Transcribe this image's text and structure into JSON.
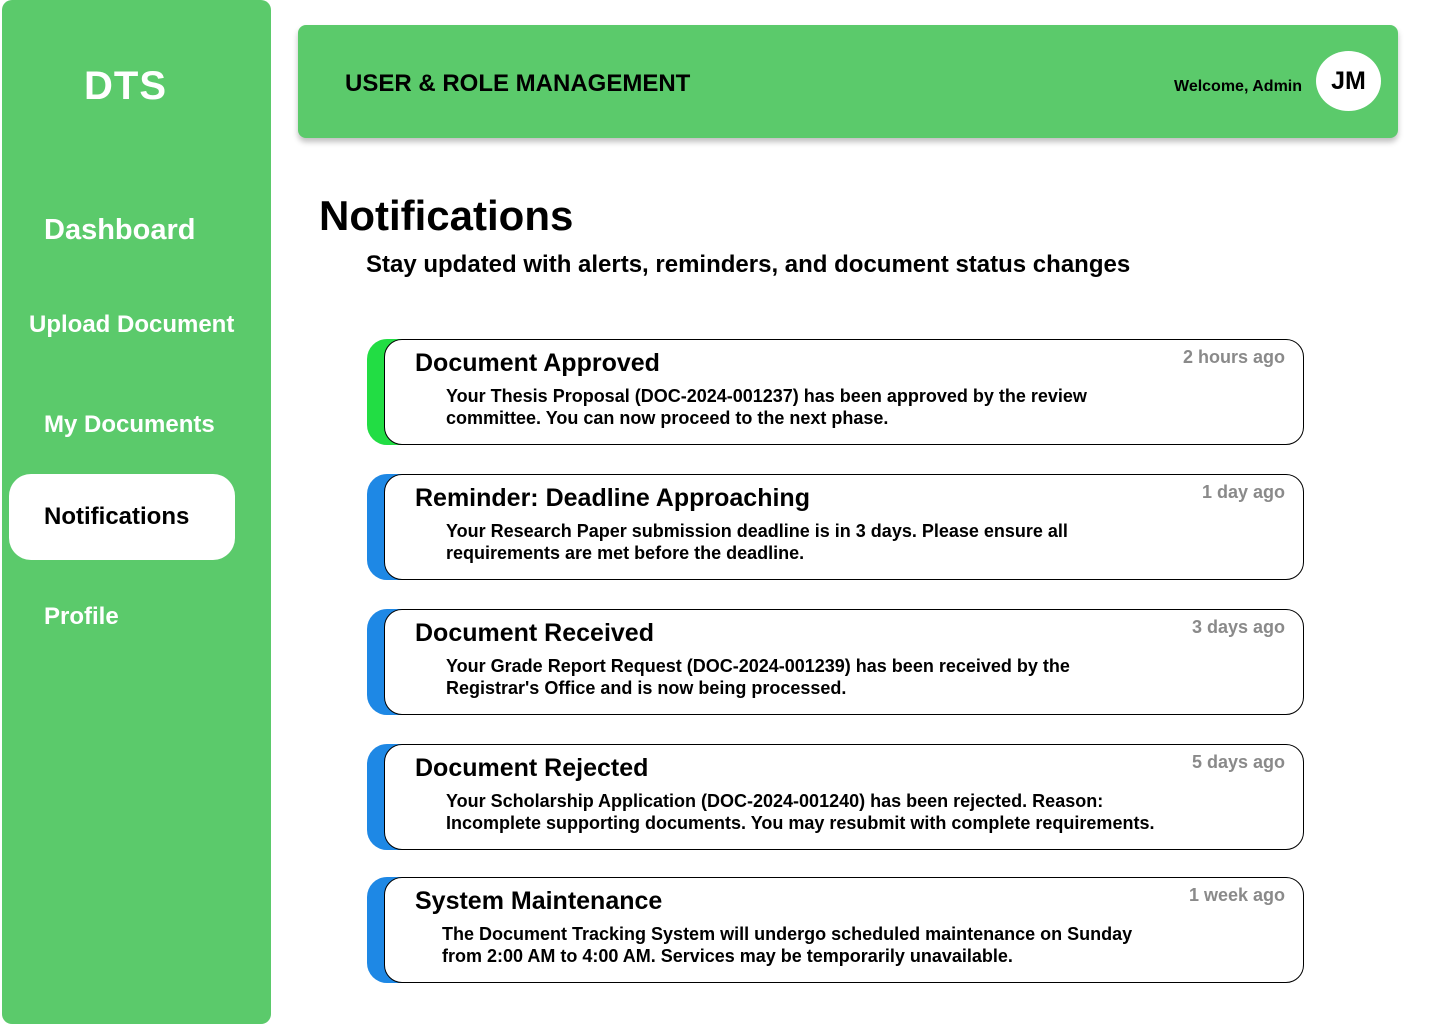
{
  "sidebar": {
    "brand": "DTS",
    "items": [
      {
        "label": "Dashboard"
      },
      {
        "label": "Upload Document"
      },
      {
        "label": "My Documents"
      },
      {
        "label": "Notifications",
        "active": true
      },
      {
        "label": "Profile"
      }
    ]
  },
  "header": {
    "title": "USER & ROLE MANAGEMENT",
    "welcome": "Welcome, Admin",
    "avatar_initials": "JM"
  },
  "page": {
    "title": "Notifications",
    "subtitle": "Stay updated with alerts, reminders, and document status changes"
  },
  "notifications": [
    {
      "title": "Document Approved",
      "time": "2 hours ago",
      "message": "Your Thesis Proposal (DOC-2024-001237) has been approved by the review committee. You can now proceed to the next phase.",
      "accent": "#22DD44"
    },
    {
      "title": "Reminder: Deadline Approaching",
      "time": "1 day ago",
      "message": "Your Research Paper submission deadline is in 3 days. Please ensure all requirements are met before the deadline.",
      "accent": "#1E88E5"
    },
    {
      "title": "Document Received",
      "time": "3 days ago",
      "message": "Your Grade Report Request (DOC-2024-001239) has been received by the Registrar's Office and is now being processed.",
      "accent": "#1E88E5"
    },
    {
      "title": "Document Rejected",
      "time": "5 days ago",
      "message": "Your Scholarship Application (DOC-2024-001240) has been rejected. Reason: Incomplete supporting documents. You may resubmit with complete requirements.",
      "accent": "#1E88E5"
    },
    {
      "title": "System Maintenance",
      "time": "1 week ago",
      "message": "The Document Tracking System will undergo scheduled maintenance on Sunday from 2:00 AM to 4:00 AM. Services may be temporarily unavailable.",
      "accent": "#1E88E5"
    }
  ],
  "colors": {
    "brand_green": "#5BCA6B",
    "approved_accent": "#22DD44",
    "info_accent": "#1E88E5",
    "timestamp_gray": "#8a8a8a"
  }
}
